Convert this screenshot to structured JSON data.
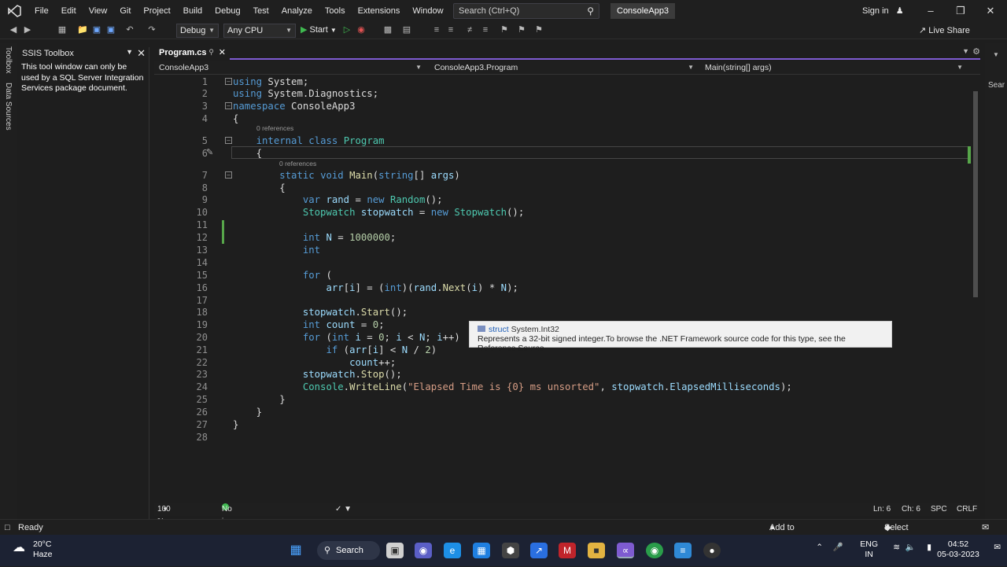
{
  "menu": {
    "items": [
      "File",
      "Edit",
      "View",
      "Git",
      "Project",
      "Build",
      "Debug",
      "Test",
      "Analyze",
      "Tools",
      "Extensions",
      "Window",
      "Help"
    ],
    "search_placeholder": "Search (Ctrl+Q)",
    "solution_name": "ConsoleApp3",
    "sign_in": "Sign in"
  },
  "toolbar": {
    "config": "Debug",
    "platform": "Any CPU",
    "start_label": "Start",
    "live_share": "Live Share"
  },
  "left_rail": {
    "tabs": [
      "Toolbox",
      "Data Sources"
    ]
  },
  "ssis_toolbox": {
    "title": "SSIS Toolbox",
    "message": "This tool window can only be used by a SQL Server Integration Services package document."
  },
  "editor": {
    "tab_title": "Program.cs",
    "nav_project": "ConsoleApp3",
    "nav_class": "ConsoleApp3.Program",
    "nav_member": "Main(string[] args)",
    "ref_lens_class": "0 references",
    "ref_lens_method": "0 references",
    "line_numbers": [
      "1",
      "2",
      "3",
      "4",
      "5",
      "6",
      "7",
      "8",
      "9",
      "10",
      "11",
      "12",
      "13",
      "14",
      "15",
      "16",
      "17",
      "18",
      "19",
      "20",
      "21",
      "22",
      "23",
      "24",
      "25",
      "26",
      "27",
      "28"
    ],
    "tooltip": {
      "kind": "struct",
      "type": "System.Int32",
      "description": "Represents a 32-bit signed integer.To browse the .NET Framework source code for this type, see the Reference Source."
    }
  },
  "editor_status": {
    "zoom": "100 %",
    "issues": "No issues found",
    "ln": "Ln: 6",
    "ch": "Ch: 6",
    "spc": "SPC",
    "crlf": "CRLF"
  },
  "status_bar": {
    "state": "Ready",
    "source_control": "Add to Source Control",
    "repository": "Select Repository"
  },
  "taskbar": {
    "temperature": "20°C",
    "weather": "Haze",
    "search_label": "Search",
    "lang": "ENG",
    "region": "IN",
    "time": "04:52",
    "date": "05-03-2023"
  }
}
